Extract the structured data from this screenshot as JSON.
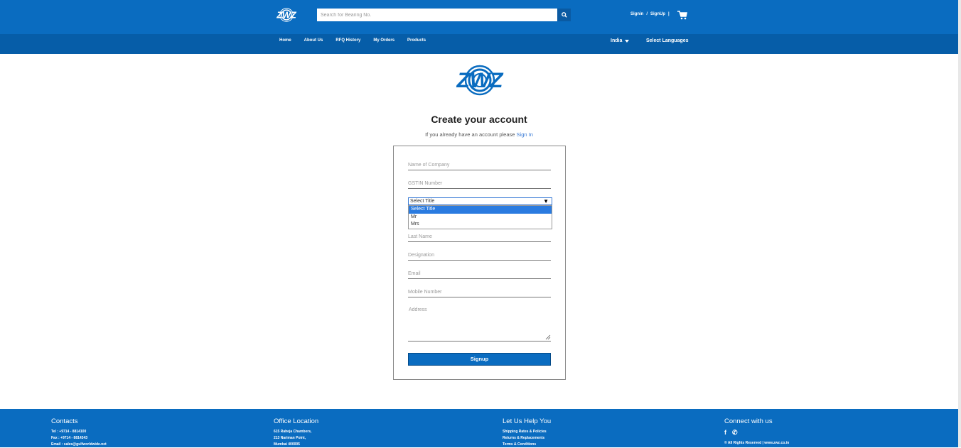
{
  "brand": {
    "logo_text": "ZWZ",
    "primary_color": "#0a6cc0",
    "nav_color": "#065da8"
  },
  "header": {
    "search_placeholder": "Search for Bearing No.",
    "signin": "Signin",
    "separator": "/",
    "signup": "SignUp",
    "pipe": "|",
    "cart_icon": "cart-icon"
  },
  "nav": {
    "items": [
      "Home",
      "About Us",
      "RFQ History",
      "My Orders",
      "Products"
    ],
    "country": "India",
    "language": "Select Languages"
  },
  "form": {
    "title": "Create your account",
    "subtitle_prefix": "If you already have an account please",
    "signin_link": "Sign In",
    "company_placeholder": "Name of Company",
    "gstin_placeholder": "GSTIN Number",
    "title_select_value": "Select Title",
    "title_options": [
      "Select Title",
      "Mr",
      "Mrs"
    ],
    "lastname_placeholder": "Last Name",
    "designation_placeholder": "Designation",
    "email_placeholder": "Email",
    "mobile_placeholder": "Mobile Number",
    "address_placeholder": "Address",
    "signup_button": "Signup"
  },
  "footer": {
    "contacts": {
      "heading": "Contacts",
      "lines": [
        "Tel : +9714 - 8814100",
        "Fax : +9714 - 8814343",
        "Email : sales@gulfworldwide.net"
      ]
    },
    "office": {
      "heading": "Office Location",
      "lines": [
        "615 Raheja Chambers,",
        "213 Nariman Point,",
        "Mumbai 400005"
      ]
    },
    "help": {
      "heading": "Let Us Help You",
      "lines": [
        "Shipping Rates & Policies",
        "Returns & Replacements",
        "Terms & Conditions"
      ]
    },
    "connect": {
      "heading": "Connect with us",
      "facebook": "f",
      "whatsapp": "✆",
      "copyright": "© All Rights Reserved | www.zwz.co.in"
    }
  }
}
